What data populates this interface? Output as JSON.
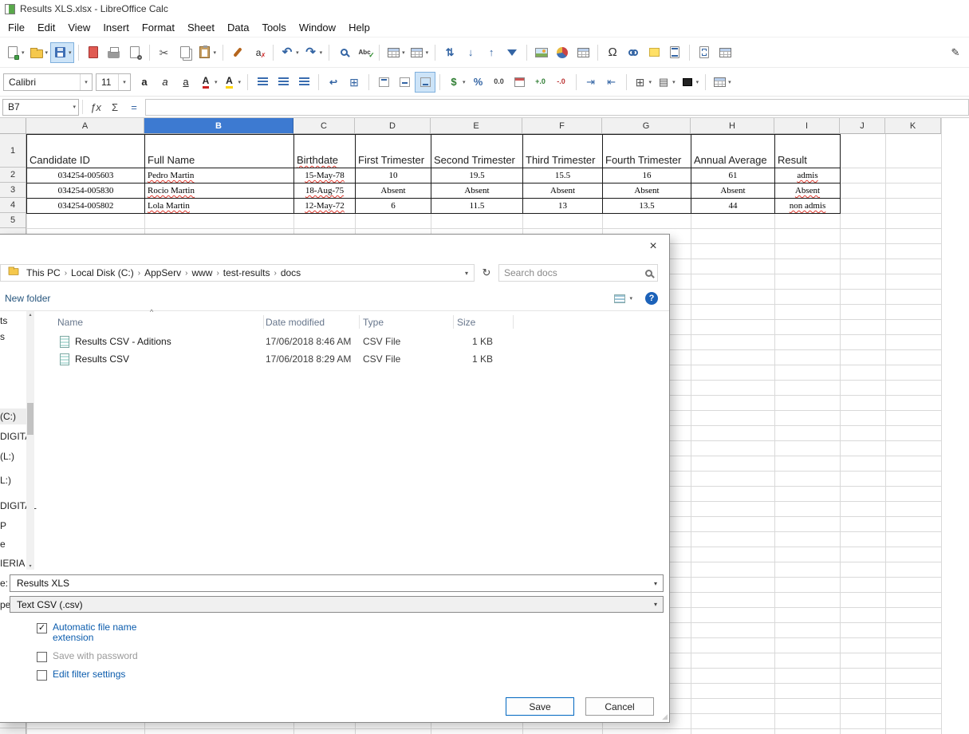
{
  "window": {
    "title": "Results XLS.xlsx - LibreOffice Calc"
  },
  "colors": {
    "selected_column_header": "#3d7ad1",
    "dialog_link_blue": "#0b5cad",
    "save_button_border": "#0067c0",
    "help_icon_blue": "#1c62b9",
    "spellcheck_red": "#e03c31"
  },
  "menubar": [
    "File",
    "Edit",
    "View",
    "Insert",
    "Format",
    "Sheet",
    "Data",
    "Tools",
    "Window",
    "Help"
  ],
  "main_toolbar": [
    {
      "name": "new-document",
      "dropdown": true
    },
    {
      "name": "open",
      "dropdown": true
    },
    {
      "name": "save",
      "dropdown": true,
      "active": true
    },
    {
      "sep": true
    },
    {
      "name": "export-pdf"
    },
    {
      "name": "print"
    },
    {
      "name": "print-preview"
    },
    {
      "sep": true
    },
    {
      "name": "cut"
    },
    {
      "name": "copy"
    },
    {
      "name": "paste",
      "dropdown": true
    },
    {
      "sep": true
    },
    {
      "name": "clone-formatting"
    },
    {
      "name": "clear-formatting"
    },
    {
      "sep": true
    },
    {
      "name": "undo",
      "dropdown": true
    },
    {
      "name": "redo",
      "dropdown": true
    },
    {
      "sep": true
    },
    {
      "name": "find-replace"
    },
    {
      "name": "spelling"
    },
    {
      "sep": true
    },
    {
      "name": "row",
      "dropdown": true
    },
    {
      "name": "column",
      "dropdown": true
    },
    {
      "sep": true
    },
    {
      "name": "sort"
    },
    {
      "name": "sort-ascending"
    },
    {
      "name": "sort-descending"
    },
    {
      "name": "autofilter"
    },
    {
      "sep": true
    },
    {
      "name": "insert-image"
    },
    {
      "name": "insert-chart"
    },
    {
      "name": "insert-pivot-table"
    },
    {
      "sep": true
    },
    {
      "name": "insert-special-character"
    },
    {
      "name": "insert-hyperlink"
    },
    {
      "name": "insert-comment"
    },
    {
      "name": "headers-footers"
    },
    {
      "sep": true
    },
    {
      "name": "define-print-area"
    },
    {
      "name": "freeze-rows-columns"
    },
    {
      "spacer": true
    },
    {
      "name": "show-draw-functions"
    }
  ],
  "format_toolbar": {
    "font_name": "Calibri",
    "font_size": "11",
    "buttons": [
      {
        "name": "bold"
      },
      {
        "name": "italic"
      },
      {
        "name": "underline"
      },
      {
        "name": "font-color",
        "dropdown": true
      },
      {
        "name": "highlighting-color",
        "dropdown": true
      },
      {
        "sep": true
      },
      {
        "name": "align-left"
      },
      {
        "name": "align-center"
      },
      {
        "name": "align-right"
      },
      {
        "sep": true
      },
      {
        "name": "wrap-text"
      },
      {
        "name": "merge-cells"
      },
      {
        "sep": true
      },
      {
        "name": "align-top"
      },
      {
        "name": "center-vertically"
      },
      {
        "name": "align-bottom",
        "active": true
      },
      {
        "sep": true
      },
      {
        "name": "format-currency",
        "dropdown": true
      },
      {
        "name": "format-percent"
      },
      {
        "name": "format-number"
      },
      {
        "name": "format-date"
      },
      {
        "name": "add-decimal"
      },
      {
        "name": "delete-decimal"
      },
      {
        "sep": true
      },
      {
        "name": "increase-indent"
      },
      {
        "name": "decrease-indent"
      },
      {
        "sep": true
      },
      {
        "name": "borders",
        "dropdown": true
      },
      {
        "name": "border-style",
        "dropdown": true
      },
      {
        "name": "border-color",
        "dropdown": true
      },
      {
        "sep": true
      },
      {
        "name": "conditional-formatting",
        "dropdown": true
      }
    ]
  },
  "formula_bar": {
    "cell_reference": "B7",
    "input_value": "",
    "icons": [
      "function-wizard",
      "sum",
      "formula"
    ]
  },
  "sheet": {
    "column_headers": [
      "A",
      "B",
      "C",
      "D",
      "E",
      "F",
      "G",
      "H",
      "I",
      "J",
      "K"
    ],
    "selected_column": "B",
    "row_headers": [
      "1",
      "2",
      "3",
      "4",
      "5"
    ],
    "table": {
      "headers": [
        "Candidate ID",
        "Full Name",
        "Birthdate",
        "First Trimester",
        "Second Trimester",
        "Third Trimester",
        "Fourth Trimester",
        "Annual Average",
        "Result"
      ],
      "rows": [
        [
          "034254-005603",
          "Pedro Martin",
          "15-May-78",
          "10",
          "19.5",
          "15.5",
          "16",
          "61",
          "admis"
        ],
        [
          "034254-005830",
          "Rocio Martin",
          "18-Aug-75",
          "Absent",
          "Absent",
          "Absent",
          "Absent",
          "Absent",
          "Absent"
        ],
        [
          "034254-005802",
          "Lola Martin",
          "12-May-72",
          "6",
          "11.5",
          "13",
          "13.5",
          "44",
          "non admis"
        ]
      ],
      "header_spellcheck_cols": [
        2
      ],
      "spellcheck_cells": [
        [
          0,
          1
        ],
        [
          0,
          2
        ],
        [
          0,
          8
        ],
        [
          1,
          1
        ],
        [
          1,
          2
        ],
        [
          1,
          8
        ],
        [
          2,
          1
        ],
        [
          2,
          2
        ],
        [
          2,
          8
        ]
      ]
    }
  },
  "save_dialog": {
    "breadcrumb": [
      "This PC",
      "Local Disk (C:)",
      "AppServ",
      "www",
      "test-results",
      "docs"
    ],
    "search_placeholder": "Search docs",
    "new_folder_label": "New folder",
    "list_columns": [
      "Name",
      "Date modified",
      "Type",
      "Size"
    ],
    "files": [
      {
        "name": "Results CSV - Aditions",
        "date_modified": "17/06/2018 8:46 AM",
        "type": "CSV File",
        "size": "1 KB"
      },
      {
        "name": "Results CSV",
        "date_modified": "17/06/2018 8:29 AM",
        "type": "CSV File",
        "size": "1 KB"
      }
    ],
    "sidebar_fragments": [
      "ts",
      "s",
      "(C:)",
      "DIGITA",
      "(L:)",
      "L:)",
      "DIGITAL",
      "P",
      "e",
      "IERIA"
    ],
    "file_name_label": "e:",
    "file_name_value": "Results XLS",
    "file_type_label": "pe:",
    "file_type_value": "Text CSV (.csv)",
    "checkboxes": [
      {
        "label": "Automatic file name extension",
        "checked": true,
        "emphasis": "link"
      },
      {
        "label": "Save with password",
        "checked": false,
        "emphasis": "muted"
      },
      {
        "label": "Edit filter settings",
        "checked": false,
        "emphasis": "link"
      }
    ],
    "save_button": "Save",
    "cancel_button": "Cancel",
    "icons": [
      "close-icon",
      "folder-icon",
      "address-dropdown-icon",
      "refresh-icon",
      "search-icon",
      "views-icon",
      "help-icon",
      "sort-caret-icon",
      "csv-file-icon",
      "scroll-up-icon",
      "scroll-down-icon",
      "resize-grip"
    ]
  }
}
